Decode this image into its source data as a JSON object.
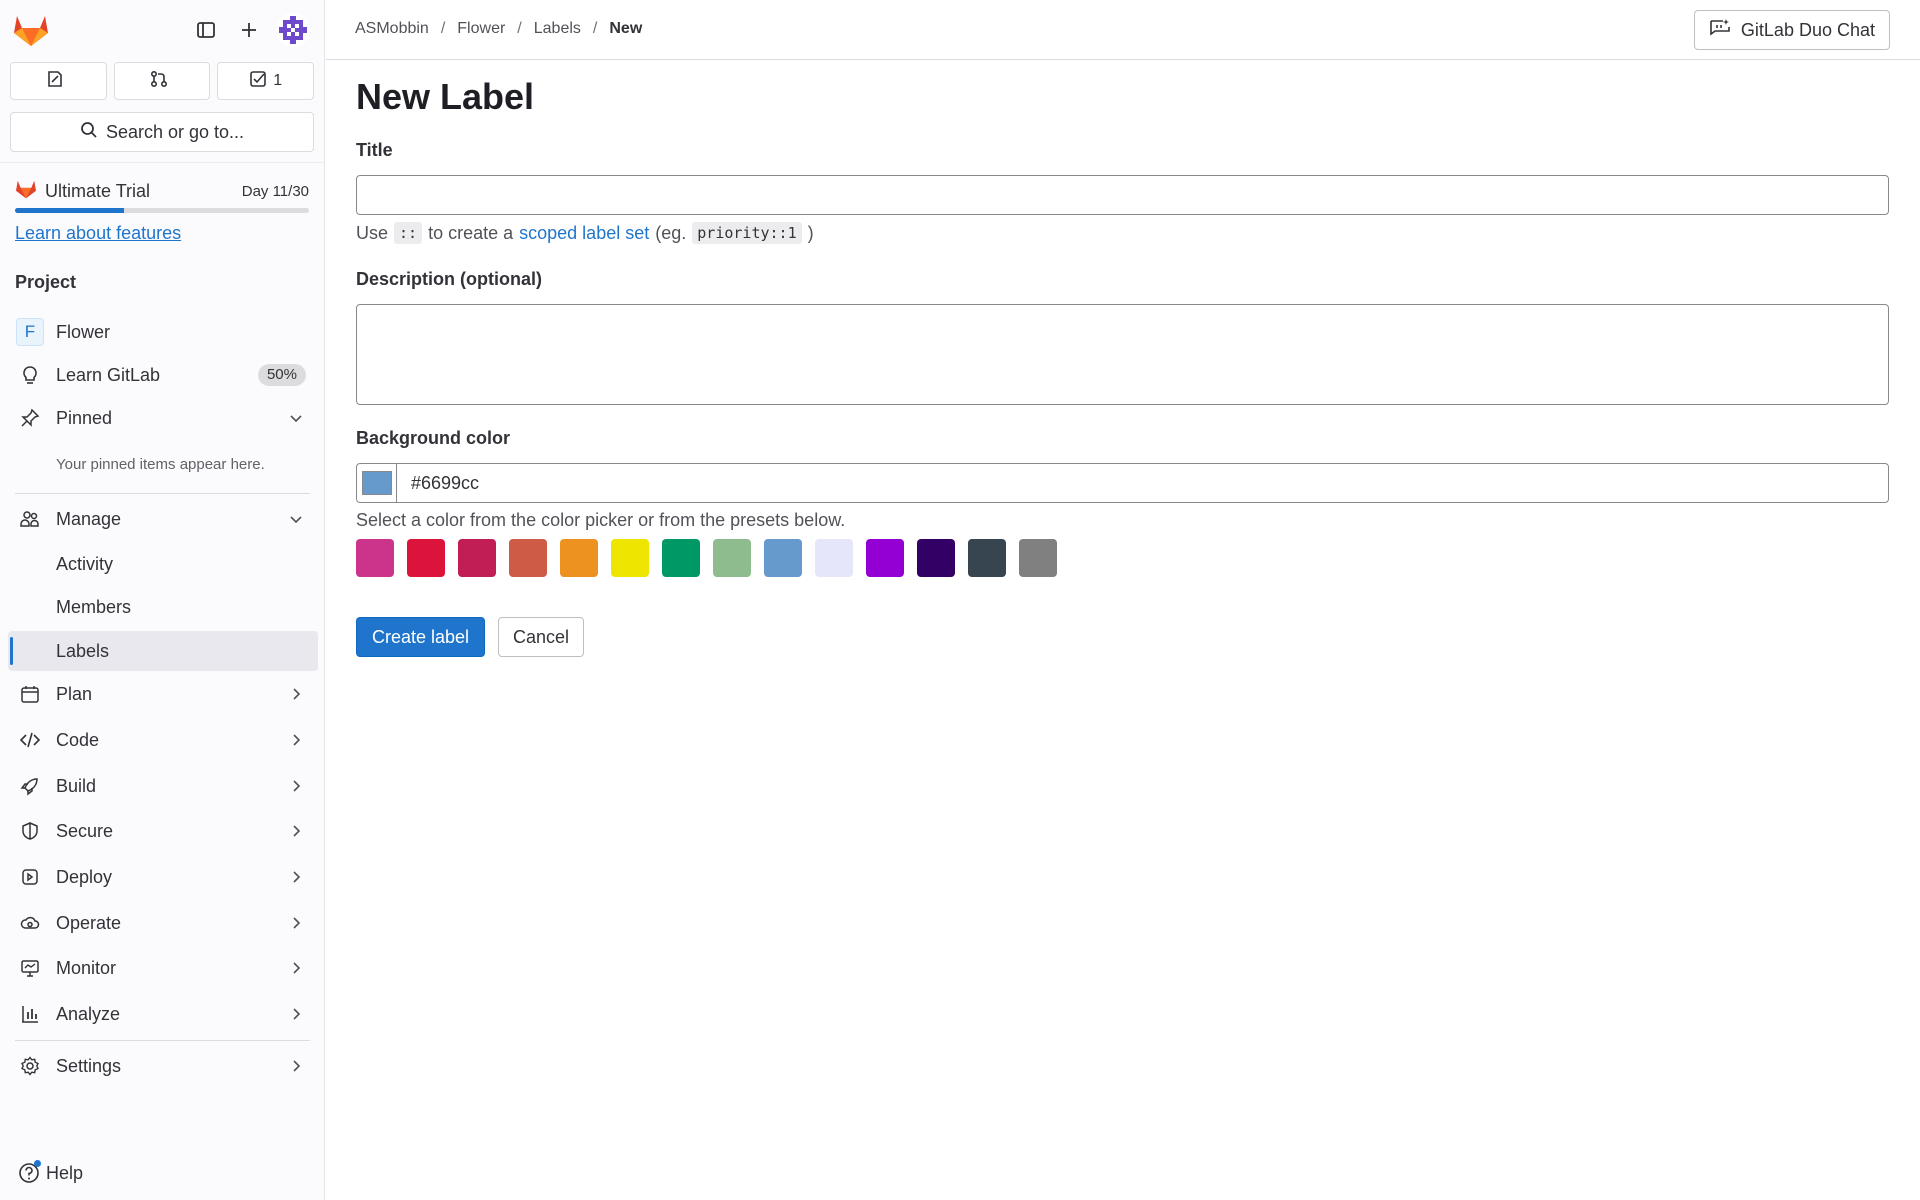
{
  "colors": {
    "accent": "#1f75cb",
    "sidebar_bg": "#fbfafd",
    "selected_color": "#6699cc"
  },
  "sidebar": {
    "counts": [
      {
        "icon": "issues-icon",
        "value": ""
      },
      {
        "icon": "merge-request-icon",
        "value": ""
      },
      {
        "icon": "todo-icon",
        "value": "1"
      }
    ],
    "search_label": "Search or go to...",
    "trial": {
      "title": "Ultimate Trial",
      "day": "Day 11/30",
      "progress": 0.37,
      "link": "Learn about features"
    },
    "section_title": "Project",
    "project": {
      "letter": "F",
      "name": "Flower"
    },
    "learn": {
      "label": "Learn GitLab",
      "badge": "50%"
    },
    "pinned": {
      "label": "Pinned",
      "note": "Your pinned items appear here."
    },
    "manage": {
      "label": "Manage",
      "items": [
        "Activity",
        "Members",
        "Labels"
      ]
    },
    "nav": [
      "Plan",
      "Code",
      "Build",
      "Secure",
      "Deploy",
      "Operate",
      "Monitor",
      "Analyze"
    ],
    "settings": "Settings",
    "help": "Help"
  },
  "topbar": {
    "breadcrumbs": [
      "ASMobbin",
      "Flower",
      "Labels",
      "New"
    ],
    "duo_button": "GitLab Duo Chat"
  },
  "form": {
    "page_title": "New Label",
    "title_label": "Title",
    "title_value": "",
    "hint_use": "Use",
    "hint_code": "::",
    "hint_middle": "to create a",
    "hint_link": "scoped label set",
    "hint_eg": "(eg.",
    "hint_example": "priority::1",
    "hint_close": ")",
    "description_label": "Description (optional)",
    "description_value": "",
    "bg_label": "Background color",
    "color_value": "#6699cc",
    "color_hint": "Select a color from the color picker or from the presets below.",
    "presets": [
      "#cc338b",
      "#dc143c",
      "#c21e56",
      "#cd5b45",
      "#ed9121",
      "#eee600",
      "#009966",
      "#8fbc8f",
      "#6699cc",
      "#e6e6fa",
      "#9400d3",
      "#330066",
      "#36454f",
      "#808080"
    ],
    "create_label": "Create label",
    "cancel_label": "Cancel"
  }
}
